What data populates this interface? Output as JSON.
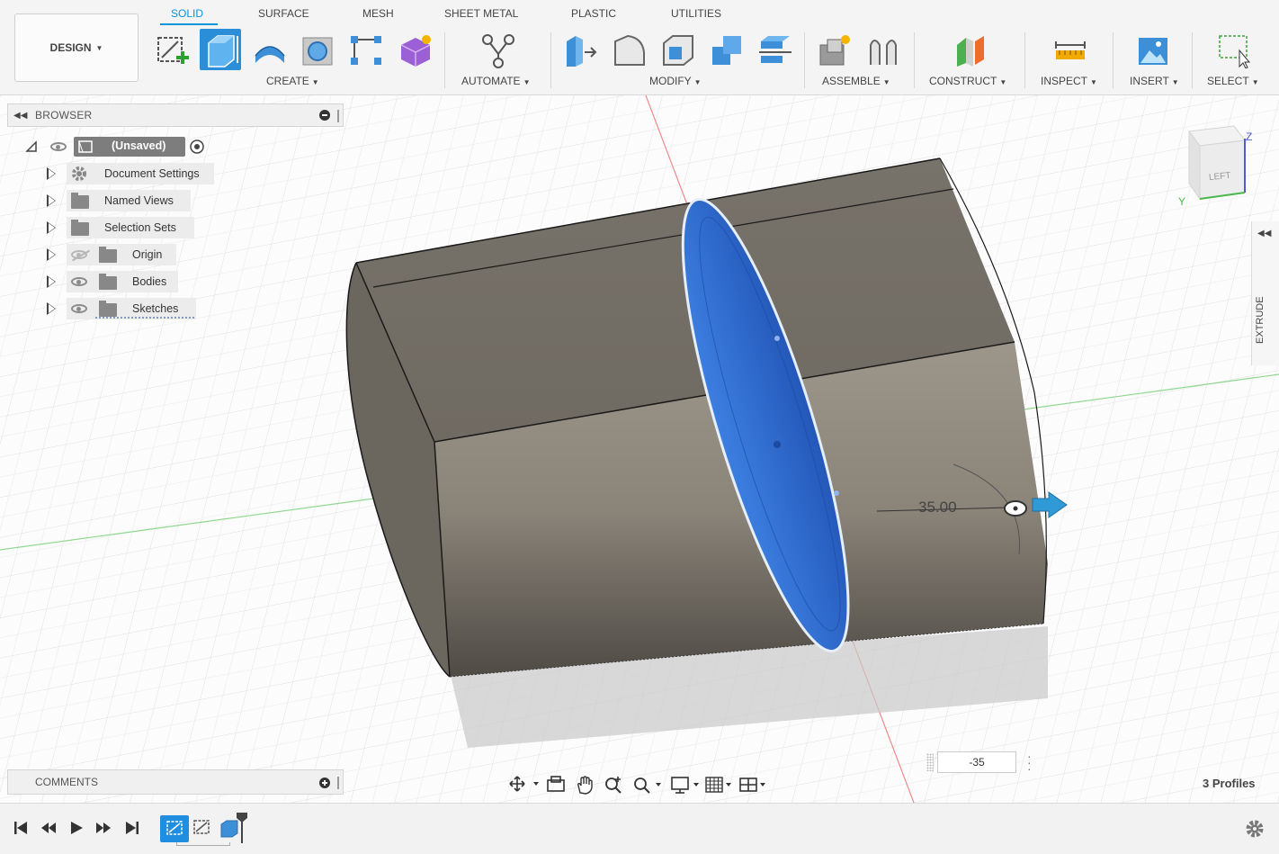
{
  "workspace": {
    "label": "DESIGN"
  },
  "tabs": [
    {
      "label": "SOLID",
      "active": true
    },
    {
      "label": "SURFACE"
    },
    {
      "label": "MESH"
    },
    {
      "label": "SHEET METAL"
    },
    {
      "label": "PLASTIC"
    },
    {
      "label": "UTILITIES"
    }
  ],
  "groups": {
    "create": "CREATE",
    "automate": "AUTOMATE",
    "modify": "MODIFY",
    "assemble": "ASSEMBLE",
    "construct": "CONSTRUCT",
    "inspect": "INSPECT",
    "insert": "INSERT",
    "select": "SELECT"
  },
  "browser": {
    "title": "BROWSER",
    "root": "(Unsaved)",
    "items": [
      {
        "label": "Document Settings"
      },
      {
        "label": "Named Views"
      },
      {
        "label": "Selection Sets"
      },
      {
        "label": "Origin"
      },
      {
        "label": "Bodies"
      },
      {
        "label": "Sketches"
      }
    ]
  },
  "comments": {
    "title": "COMMENTS"
  },
  "viewcube": {
    "face": "LEFT",
    "axes": [
      "Z",
      "Y"
    ]
  },
  "side_panel": {
    "label": "EXTRUDE"
  },
  "dimension": {
    "label": "35.00"
  },
  "distance_input": {
    "value": "-35"
  },
  "status": {
    "profiles": "3 Profiles"
  },
  "colors": {
    "accent": "#0696d7",
    "body": "#8a8479",
    "profile": "#2f6fd6",
    "timeline_feature": "#1f8ee0"
  }
}
